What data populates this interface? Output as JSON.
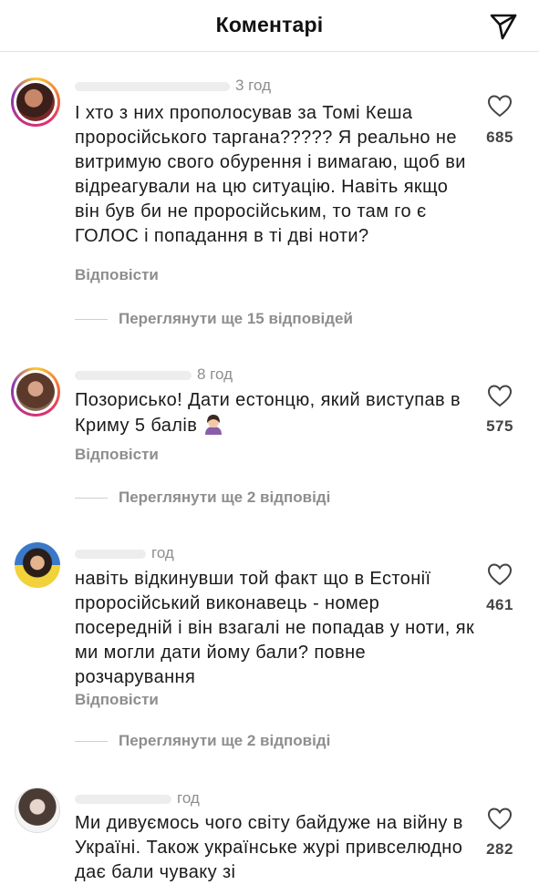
{
  "header": {
    "title": "Коментарі"
  },
  "comments": [
    {
      "time": "3 год",
      "text": "І хто з них прополосував за Томі Кеша проросійського таргана????? Я реально не витримую свого обурення і вимагаю, щоб ви відреагували на цю ситуацію. Навіть якщо він був би не проросійським, то там го є ГОЛОС і попадання в ті дві ноти?",
      "reply_label": "Відповісти",
      "likes": "685",
      "view_replies": "Переглянути ще 15 відповідей"
    },
    {
      "time": "8 год",
      "text": "Позорисько! Дати естонцю, який виступав в Криму 5 балів",
      "reply_label": "Відповісти",
      "likes": "575",
      "view_replies": "Переглянути ще 2 відповіді"
    },
    {
      "time": "год",
      "text": "навіть відкинувши той факт що в Естонії проросійський виконавець - номер посередній і він взагалі не попадав у ноти, як ми могли дати йому бали? повне розчарування",
      "reply_label": "Відповісти",
      "likes": "461",
      "view_replies": "Переглянути ще 2 відповіді"
    },
    {
      "time": "год",
      "text": "Ми дивуємось чого світу байдуже на війну в Україні. Також українське журі привселюдно дає бали чуваку зі",
      "likes": "282"
    }
  ],
  "icons": {
    "share": "send-icon",
    "like": "heart-icon",
    "emoji": "facepalm-emoji"
  }
}
